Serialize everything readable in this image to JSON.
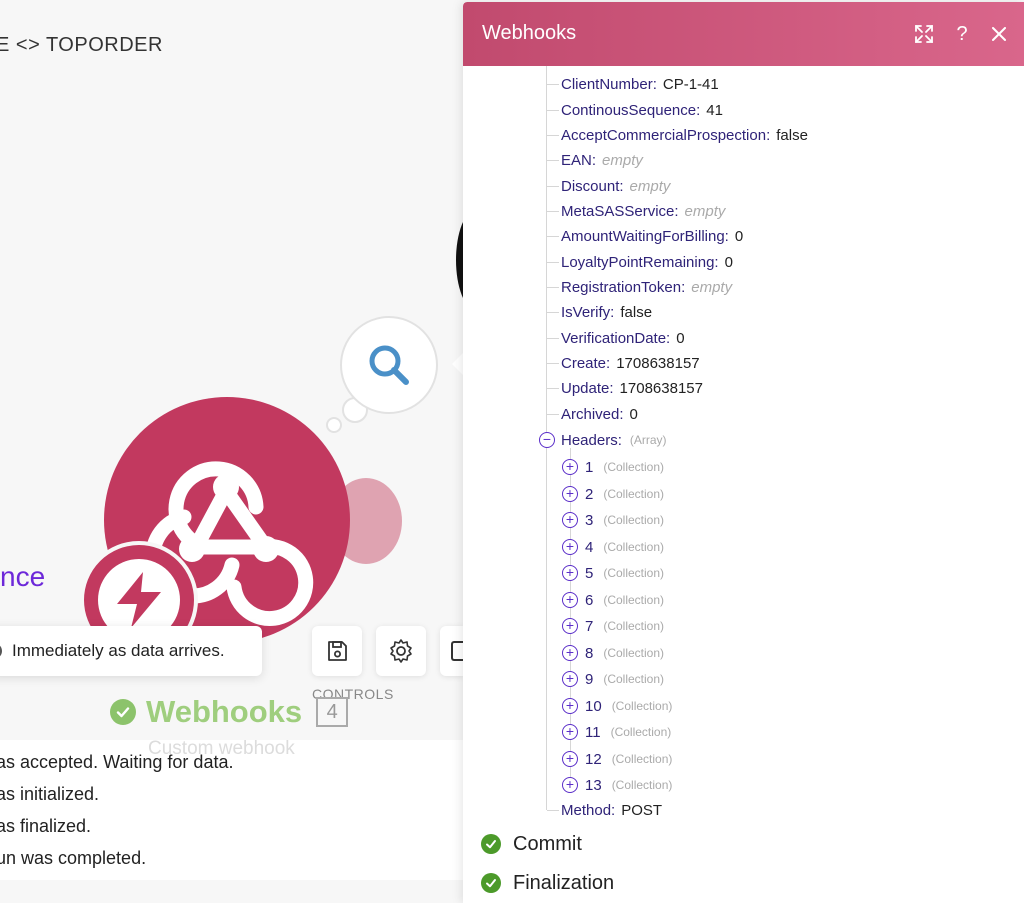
{
  "scenario": {
    "title": "E <> TOPORDER",
    "partial_label": "nce",
    "schedule_tooltip": "Immediately as data arrives.",
    "controls_label": "CONTROLS",
    "module": {
      "name": "Webhooks",
      "count": "4",
      "subtitle": "Custom webhook"
    },
    "log_lines": [
      "as accepted. Waiting for data.",
      "as initialized.",
      "as finalized.",
      "un was completed."
    ]
  },
  "panel": {
    "title": "Webhooks",
    "fields": [
      {
        "key": "ClientNumber:",
        "value": "CP-1-41"
      },
      {
        "key": "ContinousSequence:",
        "value": "41"
      },
      {
        "key": "AcceptCommercialProspection:",
        "value": "false"
      },
      {
        "key": "EAN:",
        "value": "empty"
      },
      {
        "key": "Discount:",
        "value": "empty"
      },
      {
        "key": "MetaSASService:",
        "value": "empty"
      },
      {
        "key": "AmountWaitingForBilling:",
        "value": "0"
      },
      {
        "key": "LoyaltyPointRemaining:",
        "value": "0"
      },
      {
        "key": "RegistrationToken:",
        "value": "empty"
      },
      {
        "key": "IsVerify:",
        "value": "false"
      },
      {
        "key": "VerificationDate:",
        "value": "0"
      },
      {
        "key": "Create:",
        "value": "1708638157"
      },
      {
        "key": "Update:",
        "value": "1708638157"
      },
      {
        "key": "Archived:",
        "value": "0"
      }
    ],
    "headers": {
      "key": "Headers:",
      "type": "(Array)",
      "items": [
        {
          "key": "1",
          "type": "(Collection)"
        },
        {
          "key": "2",
          "type": "(Collection)"
        },
        {
          "key": "3",
          "type": "(Collection)"
        },
        {
          "key": "4",
          "type": "(Collection)"
        },
        {
          "key": "5",
          "type": "(Collection)"
        },
        {
          "key": "6",
          "type": "(Collection)"
        },
        {
          "key": "7",
          "type": "(Collection)"
        },
        {
          "key": "8",
          "type": "(Collection)"
        },
        {
          "key": "9",
          "type": "(Collection)"
        },
        {
          "key": "10",
          "type": "(Collection)"
        },
        {
          "key": "11",
          "type": "(Collection)"
        },
        {
          "key": "12",
          "type": "(Collection)"
        },
        {
          "key": "13",
          "type": "(Collection)"
        }
      ]
    },
    "method": {
      "key": "Method:",
      "value": "POST"
    },
    "statuses": [
      {
        "label": "Commit"
      },
      {
        "label": "Finalization"
      }
    ]
  },
  "colors": {
    "brand": "#c2395f",
    "header_gradient_start": "#c14a6e",
    "header_gradient_end": "#d9668b",
    "tree_key": "#2f2378",
    "tree_toggle": "#5b2fc9",
    "success": "#4c9a2a",
    "module_success": "#8cc36b",
    "purple_text": "#6d28d9"
  },
  "icons": {
    "header": [
      "expand-icon",
      "help-icon",
      "close-icon"
    ],
    "canvas": [
      "search-icon",
      "webhook-icon",
      "lightning-icon",
      "save-icon",
      "gear-icon"
    ]
  }
}
